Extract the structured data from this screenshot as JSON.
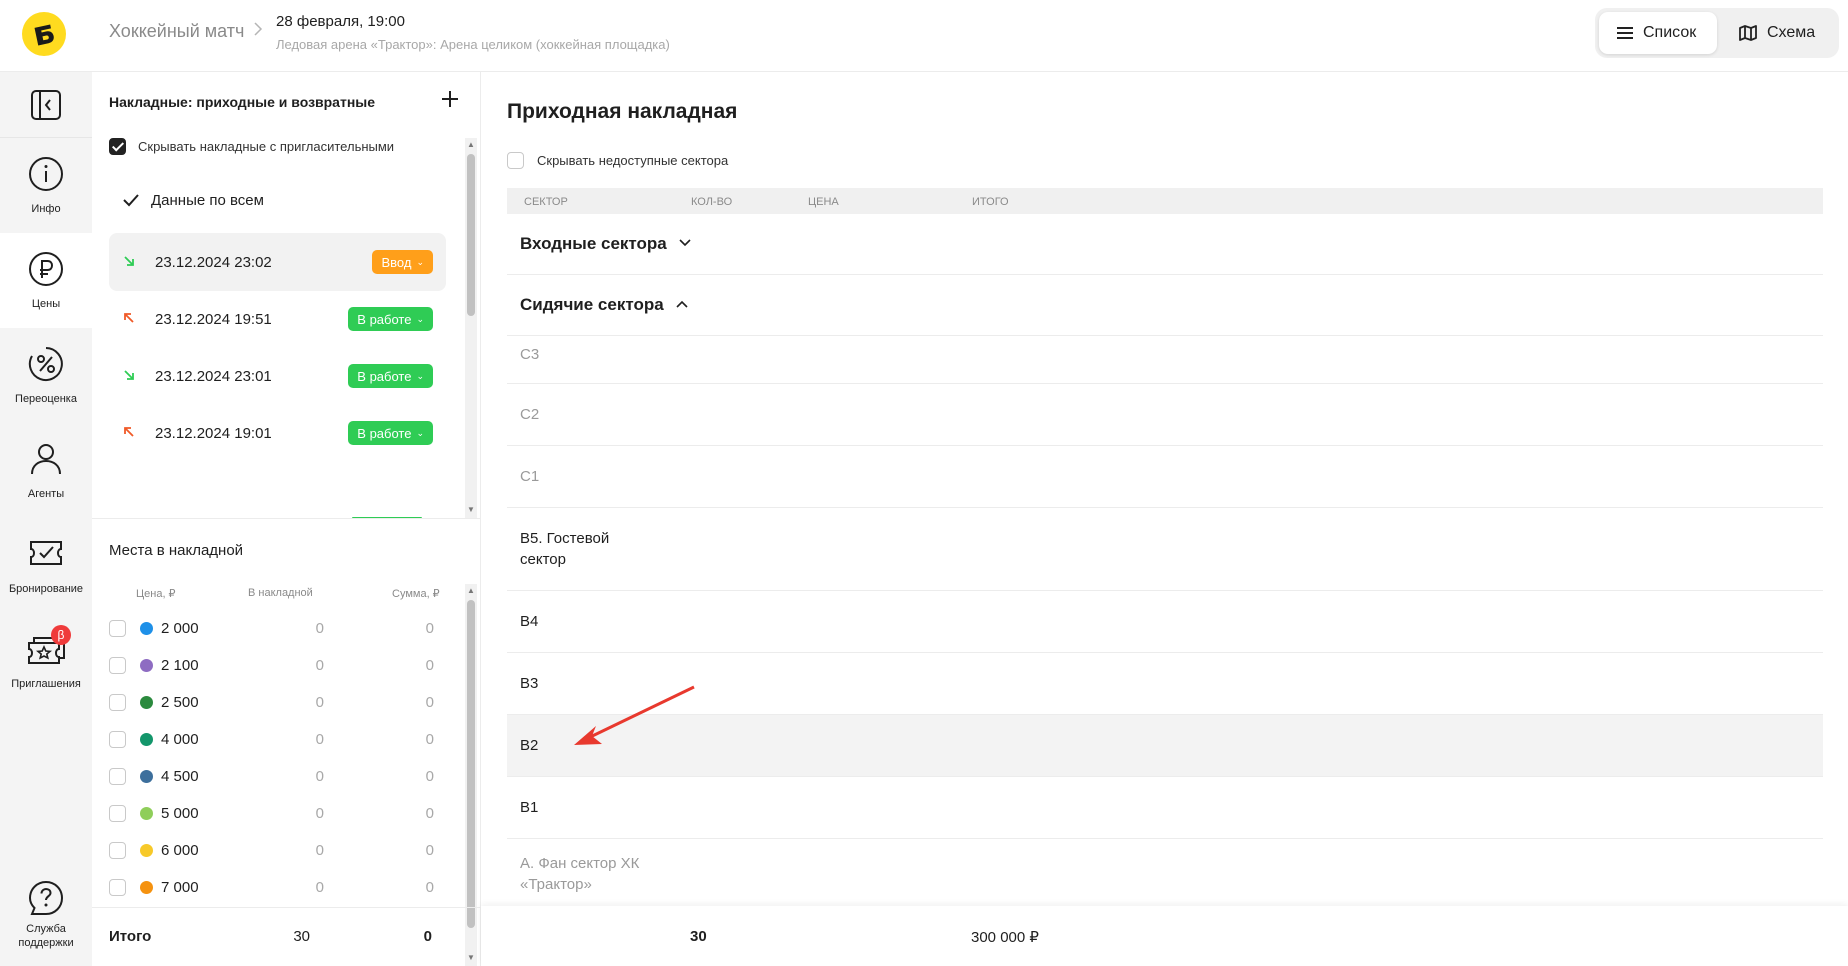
{
  "header": {
    "event_type": "Хоккейный матч",
    "separator": ">",
    "date": "28 февраля, 19:00",
    "venue": "Ледовая арена «Трактор»: Арена целиком (хоккейная площадка)",
    "view_list": "Список",
    "view_scheme": "Схема"
  },
  "sidebar": {
    "items": [
      {
        "label": "Инфо",
        "icon": "info-icon"
      },
      {
        "label": "Цены",
        "icon": "ruble-icon"
      },
      {
        "label": "Переоценка",
        "icon": "percent-icon"
      },
      {
        "label": "Агенты",
        "icon": "user-icon"
      },
      {
        "label": "Бронирование",
        "icon": "ticket-check-icon"
      },
      {
        "label": "Приглашения",
        "icon": "invitation-icon",
        "badge": "β"
      }
    ],
    "support": {
      "line1": "Служба",
      "line2": "поддержки"
    }
  },
  "invoices": {
    "title": "Накладные: приходные и возвратные",
    "hide_label": "Скрывать накладные с пригласительными",
    "all_label": "Данные по всем",
    "items": [
      {
        "datetime": "23.12.2024 23:02",
        "direction": "in",
        "status": "Ввод",
        "status_color": "#ff9f1a"
      },
      {
        "datetime": "23.12.2024 19:51",
        "direction": "out",
        "status": "В работе",
        "status_color": "#2fcc55"
      },
      {
        "datetime": "23.12.2024 23:01",
        "direction": "in",
        "status": "В работе",
        "status_color": "#2fcc55"
      },
      {
        "datetime": "23.12.2024 19:01",
        "direction": "out",
        "status": "В работе",
        "status_color": "#2fcc55"
      }
    ]
  },
  "places": {
    "title": "Места в накладной",
    "col_price": "Цена, ₽",
    "col_count": "В накладной",
    "col_sum": "Сумма, ₽",
    "rows": [
      {
        "price": "2 000",
        "count": "0",
        "sum": "0",
        "color": "#1e90e8"
      },
      {
        "price": "2 100",
        "count": "0",
        "sum": "0",
        "color": "#8e6cc2"
      },
      {
        "price": "2 500",
        "count": "0",
        "sum": "0",
        "color": "#2b8a3e"
      },
      {
        "price": "4 000",
        "count": "0",
        "sum": "0",
        "color": "#13966b"
      },
      {
        "price": "4 500",
        "count": "0",
        "sum": "0",
        "color": "#3d6f9c"
      },
      {
        "price": "5 000",
        "count": "0",
        "sum": "0",
        "color": "#8fce5a"
      },
      {
        "price": "6 000",
        "count": "0",
        "sum": "0",
        "color": "#f7c929"
      },
      {
        "price": "7 000",
        "count": "0",
        "sum": "0",
        "color": "#f5920f"
      }
    ],
    "total_label": "Итого",
    "total_count": "30",
    "total_sum": "0"
  },
  "main": {
    "title": "Приходная накладная",
    "hide_label": "Скрывать недоступные сектора",
    "columns": {
      "sector": "СЕКТОР",
      "qty": "КОЛ-ВО",
      "price": "ЦЕНА",
      "total": "ИТОГО"
    },
    "groups": [
      {
        "name": "Входные сектора",
        "expanded": false
      },
      {
        "name": "Сидячие сектора",
        "expanded": true
      }
    ],
    "sectors": [
      {
        "name": "C3",
        "dim": true
      },
      {
        "name": "C2",
        "dim": true
      },
      {
        "name": "C1",
        "dim": true
      },
      {
        "name": "B5. Гостевой сектор",
        "dim": false
      },
      {
        "name": "B4",
        "dim": false
      },
      {
        "name": "B3",
        "dim": false
      },
      {
        "name": "B2",
        "dim": false,
        "highlighted": true
      },
      {
        "name": "B1",
        "dim": false
      },
      {
        "name": "A. Фан сектор ХК «Трактор»",
        "dim": true
      }
    ],
    "footer_qty": "30",
    "footer_total": "300 000 ₽"
  },
  "colors": {
    "accent": "#ffdb1f",
    "arrow": "#e8392e"
  }
}
